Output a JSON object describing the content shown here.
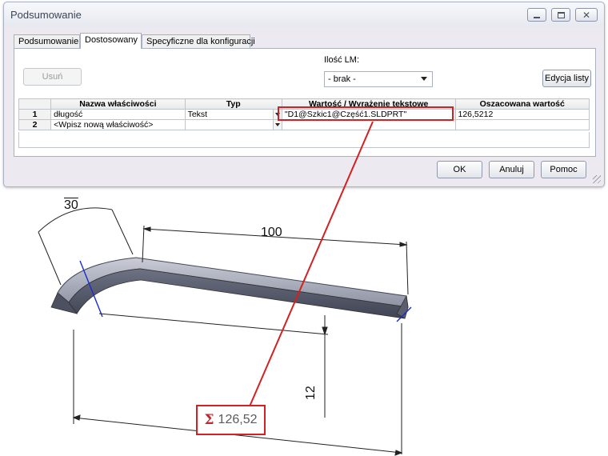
{
  "window": {
    "title": "Podsumowanie",
    "controls": {
      "minimize": "minimize-icon",
      "maximize": "maximize-icon",
      "close": "close-icon"
    }
  },
  "tabs": [
    "Podsumowanie",
    "Dostosowany",
    "Specyficzne dla konfiguracji"
  ],
  "active_tab": "Dostosowany",
  "toolbar": {
    "delete_label": "Usuń",
    "lm_label": "Ilość LM:",
    "lm_value": "- brak -",
    "edit_list_label": "Edycja listy"
  },
  "table": {
    "headers": [
      "Nazwa właściwości",
      "Typ",
      "Wartość / Wyrażenie tekstowe",
      "Oszacowana wartość"
    ],
    "rows": [
      {
        "num": "1",
        "name": "długość",
        "type": "Tekst",
        "value": "\"D1@Szkic1@Część1.SLDPRT\"",
        "estimate": "126,5212"
      },
      {
        "num": "2",
        "name": "<Wpisz nową właściwość>",
        "type": "",
        "value": "",
        "estimate": ""
      }
    ]
  },
  "buttons": {
    "ok": "OK",
    "cancel": "Anuluj",
    "help": "Pomoc"
  },
  "drawing": {
    "dim_angle": "30",
    "dim_length": "100",
    "dim_height": "12",
    "sum_symbol": "Σ",
    "sum_value": "126,52",
    "highlight_color": "#d42020"
  }
}
